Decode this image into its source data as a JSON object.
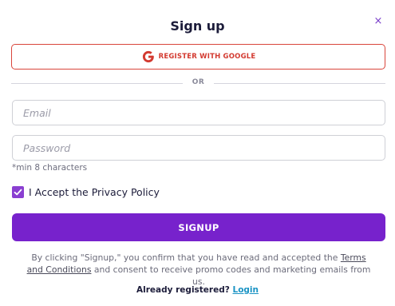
{
  "modal": {
    "title": "Sign up",
    "close_icon": "close-icon",
    "close_glyph": "×"
  },
  "google": {
    "label": "REGISTER WITH GOOGLE",
    "icon": "google-icon",
    "color": "#d33a30"
  },
  "divider": {
    "label": "OR"
  },
  "form": {
    "email": {
      "placeholder": "Email",
      "value": ""
    },
    "password": {
      "placeholder": "Password",
      "value": ""
    },
    "password_hint": "*min 8 characters",
    "privacy_checkbox": {
      "label": "I Accept the Privacy Policy",
      "checked": true
    }
  },
  "signup": {
    "label": "SIGNUP",
    "color": "#7722cc"
  },
  "disclaimer": {
    "prefix": "By clicking \"Signup,\" you confirm that you have read and accepted the ",
    "link": "Terms and Conditions",
    "suffix": " and consent to receive promo codes and marketing emails from us."
  },
  "footer": {
    "text": "Already registered?",
    "link": "Login",
    "link_color": "#1a93c4"
  }
}
